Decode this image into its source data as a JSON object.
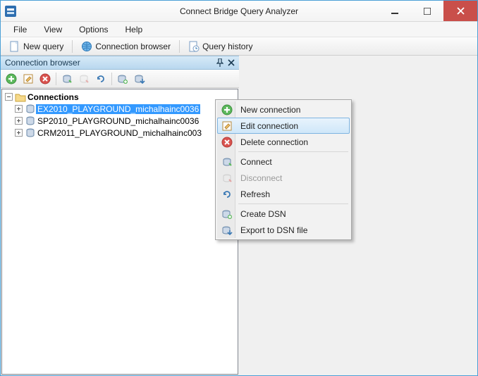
{
  "window": {
    "title": "Connect Bridge Query Analyzer"
  },
  "menubar": [
    "File",
    "View",
    "Options",
    "Help"
  ],
  "toolbar": {
    "newQuery": "New query",
    "connBrowser": "Connection browser",
    "queryHistory": "Query history"
  },
  "panel": {
    "title": "Connection browser",
    "root": "Connections",
    "items": [
      "EX2010_PLAYGROUND_michalhainc0036",
      "SP2010_PLAYGROUND_michalhainc0036",
      "CRM2011_PLAYGROUND_michalhainc003"
    ],
    "selectedIndex": 0
  },
  "contextMenu": {
    "items": [
      {
        "label": "New connection",
        "icon": "plus",
        "kind": "item"
      },
      {
        "label": "Edit connection",
        "icon": "edit",
        "kind": "item",
        "hover": true
      },
      {
        "label": "Delete connection",
        "icon": "delete",
        "kind": "item"
      },
      {
        "kind": "sep"
      },
      {
        "label": "Connect",
        "icon": "connect",
        "kind": "item"
      },
      {
        "label": "Disconnect",
        "icon": "disconn",
        "kind": "item",
        "disabled": true
      },
      {
        "label": "Refresh",
        "icon": "refresh",
        "kind": "item"
      },
      {
        "kind": "sep"
      },
      {
        "label": "Create DSN",
        "icon": "dsn",
        "kind": "item"
      },
      {
        "label": "Export to DSN file",
        "icon": "export",
        "kind": "item"
      }
    ]
  }
}
